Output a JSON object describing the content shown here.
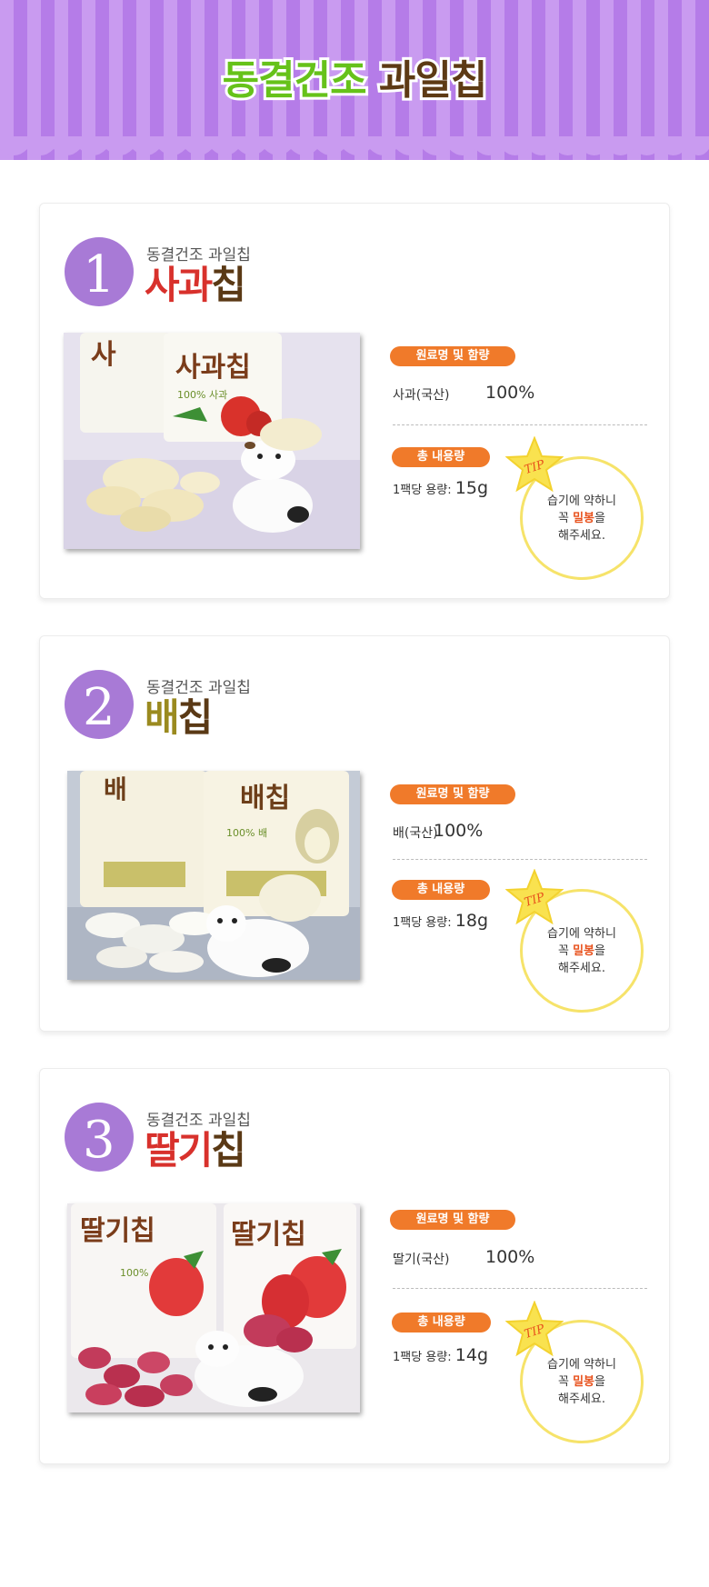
{
  "header": {
    "title_part1": "동결건조",
    "title_part2": "과일칩"
  },
  "products": [
    {
      "number": "1",
      "subtitle": "동결건조 과일칩",
      "name_part1": "사과",
      "name_part2": "칩",
      "name_color": "#d8312c",
      "ingredient_label": "원료명 및 함량",
      "ingredient_name": "사과(국산)",
      "ingredient_percent": "100%",
      "volume_label": "총 내용량",
      "volume_prefix": "1팩당 용량:",
      "volume_value": "15g",
      "tip_badge": "TIP",
      "tip_line1": "습기에 약하니",
      "tip_line2_a": "꼭 ",
      "tip_line2_b": "밀봉",
      "tip_line2_c": "을",
      "tip_line3": "해주세요.",
      "package_label": "사과칩",
      "package_percent": "100% 사과"
    },
    {
      "number": "2",
      "subtitle": "동결건조 과일칩",
      "name_part1": "배",
      "name_part2": "칩",
      "name_color": "#9a8a1f",
      "ingredient_label": "원료명 및 함량",
      "ingredient_name": "배(국산)",
      "ingredient_percent": "100%",
      "volume_label": "총 내용량",
      "volume_prefix": "1팩당 용량:",
      "volume_value": "18g",
      "tip_badge": "TIP",
      "tip_line1": "습기에 약하니",
      "tip_line2_a": "꼭 ",
      "tip_line2_b": "밀봉",
      "tip_line2_c": "을",
      "tip_line3": "해주세요.",
      "package_label": "배칩",
      "package_percent": "100% 배"
    },
    {
      "number": "3",
      "subtitle": "동결건조 과일칩",
      "name_part1": "딸기",
      "name_part2": "칩",
      "name_color": "#d8312c",
      "ingredient_label": "원료명 및 함량",
      "ingredient_name": "딸기(국산)",
      "ingredient_percent": "100%",
      "volume_label": "총 내용량",
      "volume_prefix": "1팩당 용량:",
      "volume_value": "14g",
      "tip_badge": "TIP",
      "tip_line1": "습기에 약하니",
      "tip_line2_a": "꼭 ",
      "tip_line2_b": "밀봉",
      "tip_line2_c": "을",
      "tip_line3": "해주세요.",
      "package_label": "딸기칩",
      "package_percent": "100%"
    }
  ],
  "colors": {
    "header_purple": "#b57ce8",
    "accent_orange": "#f07a2a",
    "number_purple": "#a87ad6",
    "tip_yellow": "#f6e36a",
    "title_green": "#66c21a",
    "title_brown": "#5d3a14"
  }
}
